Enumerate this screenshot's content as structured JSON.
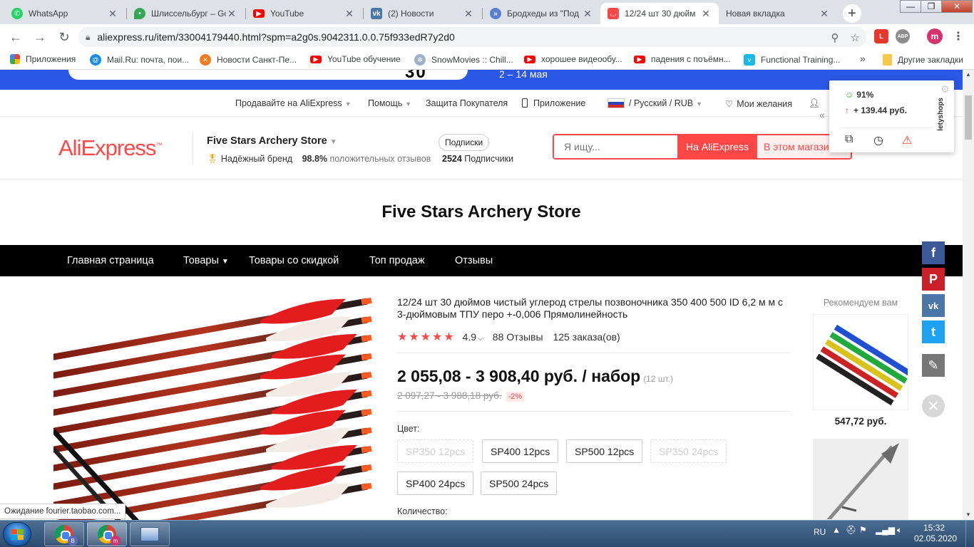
{
  "browser": {
    "tabs": [
      {
        "label": "WhatsApp",
        "icon": "whatsapp-icon",
        "color": "#25d366"
      },
      {
        "label": "Шлиссельбург – Go",
        "icon": "google-maps-icon",
        "color": "#34a853"
      },
      {
        "label": "YouTube",
        "icon": "youtube-icon",
        "color": "#ff0000"
      },
      {
        "label": "(2) Новости",
        "icon": "vk-icon",
        "color": "#4a76a8"
      },
      {
        "label": "Бродхеды из \"Под",
        "icon": "site-icon",
        "color": "#5b7fd1"
      },
      {
        "label": "12/24 шт 30 дюйм",
        "icon": "aliexpress-icon",
        "color": "#ff4747",
        "active": true
      },
      {
        "label": "Новая вкладка",
        "icon": "",
        "color": ""
      }
    ],
    "tab_close": "✕",
    "new_tab": "+",
    "window_controls": [
      "—",
      "❐",
      "✕"
    ],
    "url": "aliexpress.ru/item/33004179440.html?spm=a2g0s.9042311.0.0.75f933edR7y2d0",
    "extensions": [
      {
        "icon": "lety-extension-icon",
        "text": "L",
        "color": "#e6382b"
      },
      {
        "icon": "adblock-extension-icon",
        "text": "ABP",
        "color": "#8d8d8d"
      },
      {
        "icon": "profile-avatar-icon",
        "text": "m",
        "color": "#d6336c"
      }
    ],
    "bookmarks": [
      {
        "label": "Приложения",
        "icon": "apps-grid-icon"
      },
      {
        "label": "Mail.Ru: почта, пои...",
        "icon": "mailru-icon"
      },
      {
        "label": "Новости Санкт-Пе...",
        "icon": "news-icon"
      },
      {
        "label": "YouTube обучение",
        "icon": "youtube-icon"
      },
      {
        "label": "SnowMovies :: Chill...",
        "icon": "snowmovies-icon"
      },
      {
        "label": "хорошее видеообу...",
        "icon": "youtube-icon"
      },
      {
        "label": "падения с поъёмн...",
        "icon": "youtube-icon"
      },
      {
        "label": "Functional Training...",
        "icon": "vimeo-icon"
      }
    ],
    "bookmarks_more": "»",
    "other_bookmarks": "Другие закладки"
  },
  "promo": {
    "digits": "30 ",
    "text": "2 – 14 мая"
  },
  "topnav": {
    "sell": "Продавайте на AliExpress",
    "help": "Помощь",
    "protection": "Защита Покупателя",
    "app": "Приложение",
    "locale": "/ Русский /  RUB",
    "wishlist": "Мои желания"
  },
  "store": {
    "logo": "AliExpress",
    "name": "Five Stars Archery Store",
    "brand_label": "Надёжный бренд",
    "positive_pct": "98.8%",
    "positive_label": "положительных отзывов",
    "subscribe_label": "Подписки",
    "subscriber_count": "2524",
    "subscribers_label": "Подписчики",
    "title": "Five Stars Archery Store"
  },
  "search": {
    "placeholder": "Я ищу...",
    "btn_all": "На AliExpress",
    "btn_store": "В этом магазине"
  },
  "store_menu": [
    "Главная страница",
    "Товары",
    "Товары со скидкой",
    "Топ продаж",
    "Отзывы"
  ],
  "product": {
    "title": "12/24 шт 30 дюймов чистый углерод стрелы позвоночника 350 400 500 ID 6,2 м м с 3-дюймовым ТПУ перо +-0,006 Прямолинейность",
    "stars": "★★★★★",
    "rating": "4.9",
    "reviews": "88 Отзывы",
    "orders": "125 заказа(ов)",
    "price": "2 055,08 - 3 908,40 руб. / набор",
    "unit": "(12 шт.)",
    "old_price": "2 097,27 - 3 988,18 руб.",
    "discount": "-2%",
    "color_label": "Цвет:",
    "options": [
      {
        "label": "SP350 12pcs",
        "disabled": true
      },
      {
        "label": "SP400 12pcs",
        "disabled": false
      },
      {
        "label": "SP500 12pcs",
        "disabled": false
      },
      {
        "label": "SP350 24pcs",
        "disabled": true
      },
      {
        "label": "SP400 24pcs",
        "disabled": false
      },
      {
        "label": "SP500 24pcs",
        "disabled": false
      }
    ],
    "quantity_label": "Количество:"
  },
  "recommend": {
    "title": "Рекомендуем вам",
    "items": [
      {
        "price": "547,72 руб."
      },
      {
        "price": ""
      }
    ]
  },
  "social": [
    {
      "icon": "facebook-icon",
      "glyph": "f",
      "color": "#3b5998"
    },
    {
      "icon": "pinterest-icon",
      "glyph": "P",
      "color": "#cb2027"
    },
    {
      "icon": "vk-icon",
      "glyph": "vk",
      "color": "#4a76a8"
    },
    {
      "icon": "twitter-icon",
      "glyph": "t",
      "color": "#1da1f2"
    },
    {
      "icon": "edit-icon",
      "glyph": "✎",
      "color": "#777777"
    }
  ],
  "lety": {
    "percent": "91%",
    "cashback": "+ 139.44 руб.",
    "brand": "letyshops"
  },
  "status": "Ожидание fourier.taobao.com...",
  "taskbar": {
    "lang": "RU",
    "time": "15:32",
    "date": "02.05.2020",
    "badges": [
      "B",
      "m"
    ]
  }
}
